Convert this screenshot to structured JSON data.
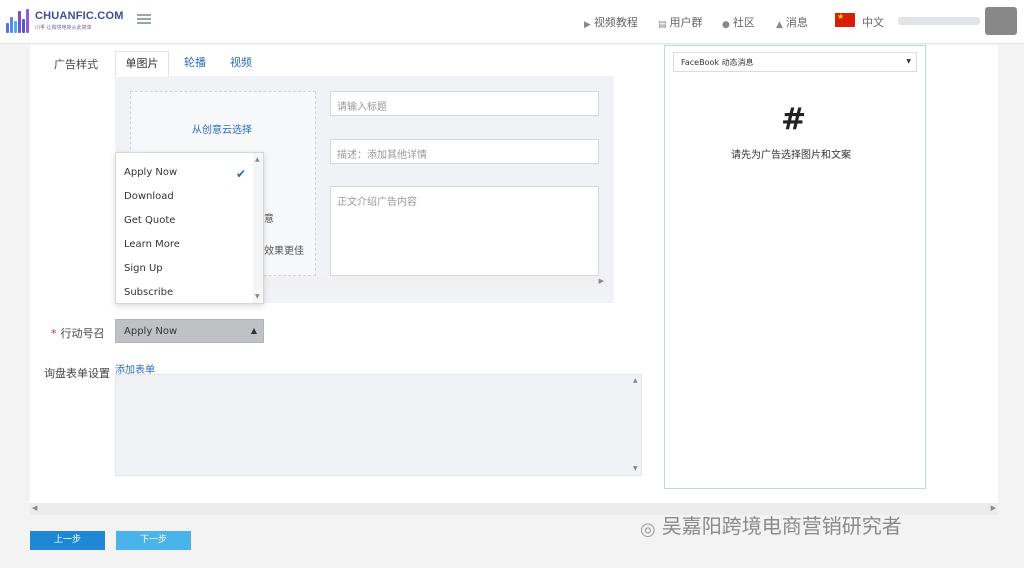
{
  "brand": {
    "name": "CHUANFIC.COM",
    "slogan": "川孚 让跨境电商从此简单",
    "bar_colors": [
      "#5a6fd6",
      "#6a7fe0",
      "#3db5e6",
      "#7c4dcc",
      "#4a60c8",
      "#9b59d0",
      "#3d8fd8"
    ]
  },
  "nav": {
    "video_tutorial": "视频教程",
    "user_group": "用户群",
    "community": "社区",
    "messages": "消息",
    "language": "中文"
  },
  "form": {
    "ad_style_label": "广告样式",
    "tabs": [
      "单图片",
      "轮播",
      "视频"
    ],
    "cloud_select": "从创意云选择",
    "partial_text_1": "意",
    "partial_text_2": "效果更佳",
    "title_placeholder": "请输入标题",
    "desc_placeholder": "描述：添加其他详情",
    "body_placeholder": "正文介绍广告内容",
    "cta_label": "行动号召",
    "cta_required": "*",
    "cta_options": [
      "Apply Now",
      "Download",
      "Get Quote",
      "Learn More",
      "Sign Up",
      "Subscribe"
    ],
    "cta_selected": "Apply Now",
    "inquiry_label": "询盘表单设置",
    "add_form_link": "添加表单"
  },
  "preview": {
    "placement": "FaceBook 动态消息",
    "empty_message": "请先为广告选择图片和文案"
  },
  "buttons": {
    "prev": "上一步",
    "next": "下一步"
  },
  "watermark": "吴嘉阳跨境电商营销研究者",
  "colors": {
    "accent": "#2a6ebb",
    "prev_button": "#1e88d6",
    "next_button": "#4ab3ea",
    "flag": "#d81e06"
  }
}
